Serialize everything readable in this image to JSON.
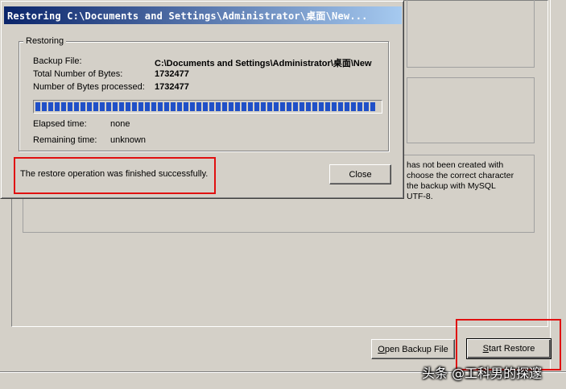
{
  "background": {
    "text_lines": [
      "has not been created with",
      "choose the correct character",
      "the backup with MySQL",
      "UTF-8."
    ],
    "open_backup_button": {
      "underline": "O",
      "rest": "pen Backup File"
    },
    "start_restore_button": {
      "underline": "S",
      "rest": "tart Restore"
    }
  },
  "dialog": {
    "title": "Restoring C:\\Documents and Settings\\Administrator\\桌面\\New...",
    "group_label": "Restoring",
    "fields": {
      "backup_file_label": "Backup File:",
      "backup_file_value": "C:\\Documents and Settings\\Administrator\\桌面\\New",
      "total_bytes_label": "Total Number of Bytes:",
      "total_bytes_value": "1732477",
      "processed_bytes_label": "Number of Bytes processed:",
      "processed_bytes_value": "1732477",
      "elapsed_label": "Elapsed time:",
      "elapsed_value": "none",
      "remaining_label": "Remaining time:",
      "remaining_value": "unknown"
    },
    "progress_percent": 100,
    "message": "The restore operation was finished successfully.",
    "close_label": "Close"
  },
  "colors": {
    "annotation": "#e01010",
    "progress": "#2050c8",
    "title_start": "#0a246a"
  },
  "watermark": "头条 @工科男的探邃"
}
